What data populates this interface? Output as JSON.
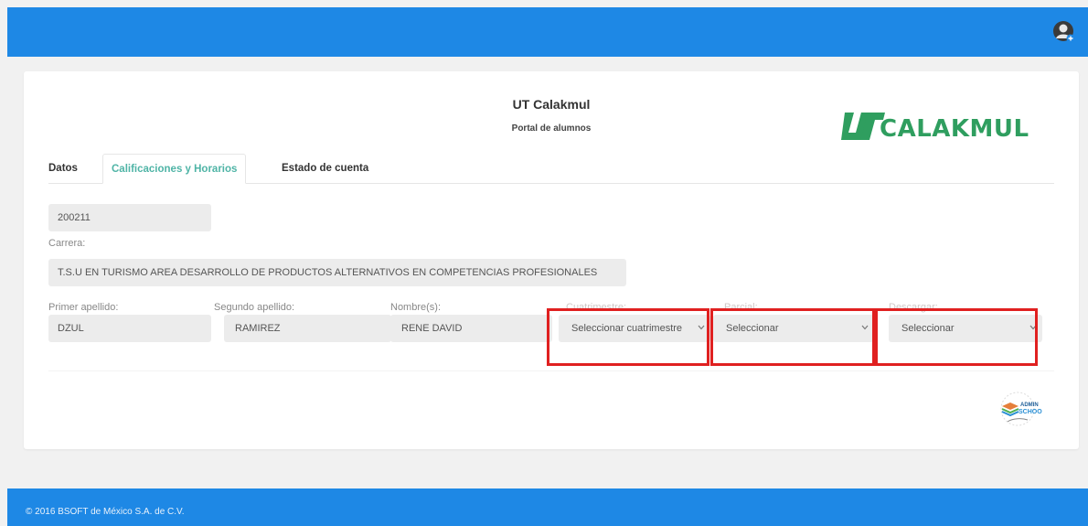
{
  "header": {
    "user_icon": "user-add-icon"
  },
  "portal": {
    "title": "UT Calakmul",
    "subtitle": "Portal de alumnos"
  },
  "logo": {
    "text": "CALAKMUL",
    "color": "#2f9e5f"
  },
  "tabs": [
    {
      "label": "Datos",
      "active": false
    },
    {
      "label": "Calificaciones y Horarios",
      "active": true
    },
    {
      "label": "Estado de cuenta",
      "active": false
    }
  ],
  "student": {
    "id": "200211",
    "career_label": "Carrera:",
    "career": "T.S.U EN TURISMO AREA DESARROLLO DE PRODUCTOS ALTERNATIVOS EN COMPETENCIAS PROFESIONALES",
    "first_surname_label": "Primer apellido:",
    "first_surname": "DZUL",
    "second_surname_label": "Segundo apellido:",
    "second_surname": "RAMIREZ",
    "names_label": "Nombre(s):",
    "names": "RENE DAVID"
  },
  "selectors": {
    "cuatrimestre_label": "Cuatrimestre:",
    "cuatrimestre_value": "Seleccionar cuatrimestre",
    "parcial_label": "Parcial:",
    "parcial_value": "Seleccionar",
    "descargar_label": "Descargar:",
    "descargar_value": "Seleccionar"
  },
  "footer": {
    "text": "© 2016 BSOFT de México S.A. de C.V."
  },
  "colors": {
    "accent": "#1e88e5",
    "active_tab": "#4fb4a6",
    "highlight": "#e02020"
  }
}
